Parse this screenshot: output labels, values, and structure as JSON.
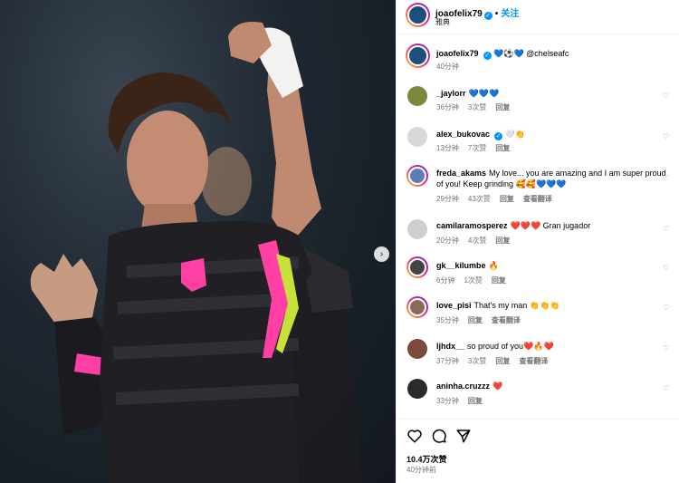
{
  "header": {
    "username": "joaofelix79",
    "follow_label": "关注",
    "location": "雅典"
  },
  "caption": {
    "username": "joaofelix79",
    "text": "💙⚽️💙 @chelseafc",
    "time": "40分钟"
  },
  "comments": [
    {
      "username": "_jaylorr",
      "text": "💙💙💙",
      "time": "36分钟",
      "likes": "3次赞",
      "reply": "回复",
      "translate": ""
    },
    {
      "username": "alex_bukovac",
      "text": "🤍👏",
      "time": "13分钟",
      "likes": "7次赞",
      "reply": "回复",
      "translate": "",
      "verified": true
    },
    {
      "username": "freda_akams",
      "text": "My love... you are amazing and I am super proud of you! Keep grinding 🥰🥰💙💙💙",
      "time": "29分钟",
      "likes": "43次赞",
      "reply": "回复",
      "translate": "查看翻译"
    },
    {
      "username": "camilaramosperez",
      "text": "❤️❤️❤️ Gran jugador",
      "time": "20分钟",
      "likes": "4次赞",
      "reply": "回复",
      "translate": ""
    },
    {
      "username": "gk__kilumbe",
      "text": "🔥",
      "time": "6分钟",
      "likes": "1次赞",
      "reply": "回复",
      "translate": ""
    },
    {
      "username": "love_pisi",
      "text": "That's my man 👏👏👏",
      "time": "35分钟",
      "likes": "回复",
      "reply": "查看翻译",
      "translate": ""
    },
    {
      "username": "ljhdx__",
      "text": "so proud of you❤️🔥❤️",
      "time": "37分钟",
      "likes": "3次赞",
      "reply": "回复",
      "translate": "查看翻译"
    },
    {
      "username": "aninha.cruzzz",
      "text": "❤️",
      "time": "33分钟",
      "likes": "回复",
      "reply": "",
      "translate": ""
    }
  ],
  "footer": {
    "likes": "10.4万次赞",
    "posted": "40分钟前"
  },
  "icons": [
    "heart-icon",
    "comment-icon",
    "share-icon",
    "chevron-right-icon",
    "verified-icon"
  ],
  "colors": {
    "accent": "#0095f6",
    "kit_pink": "#ff3fa4",
    "kit_lime": "#c8e13a"
  }
}
